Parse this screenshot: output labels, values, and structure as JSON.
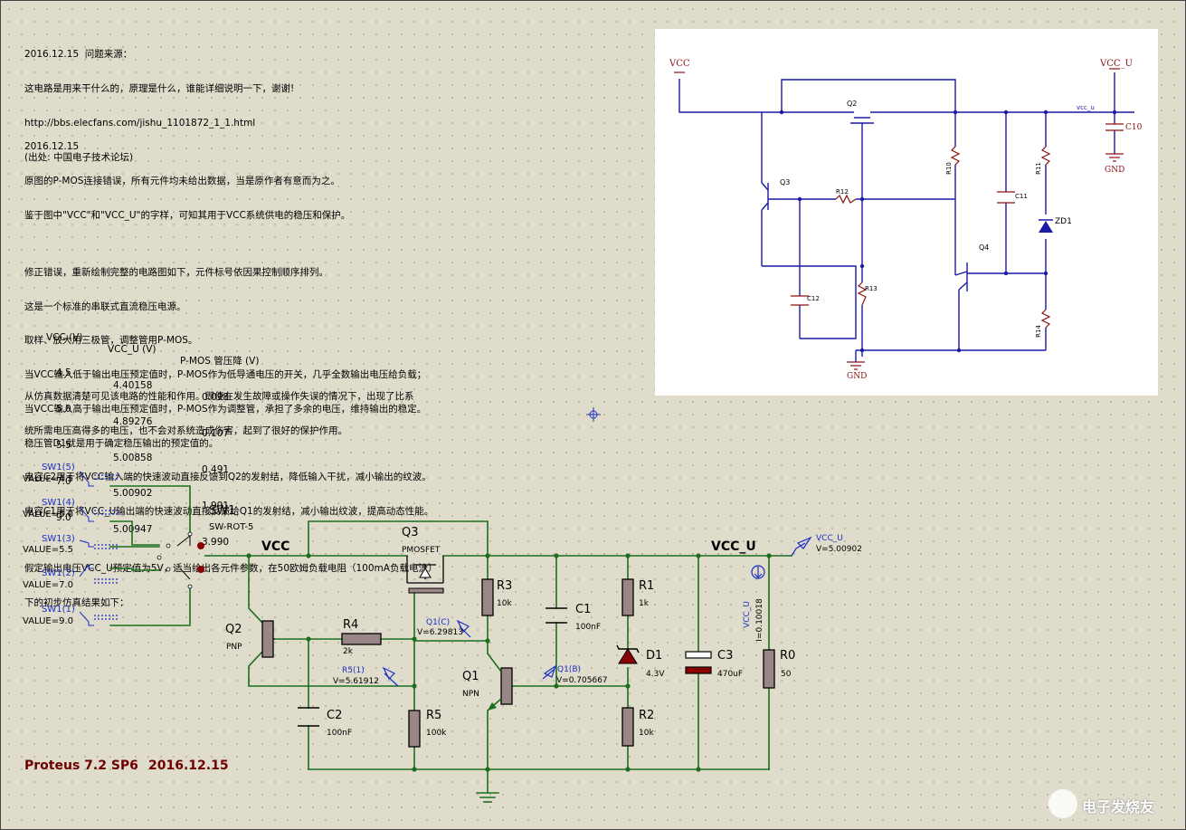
{
  "notes": {
    "block1": [
      "2016.12.15  问题来源：",
      "这电路是用来干什么的，原理是什么，谁能详细说明一下，谢谢!",
      "http://bbs.elecfans.com/jishu_1101872_1_1.html",
      "(出处: 中国电子技术论坛)"
    ],
    "block2": [
      "2016.12.15",
      "原图的P-MOS连接错误，所有元件均未给出数据，当是原作者有意而为之。",
      "鉴于图中\"VCC\"和\"VCC_U\"的字样，可知其用于VCC系统供电的稳压和保护。",
      "",
      "修正错误，重新绘制完整的电路图如下，元件标号依因果控制顺序排列。",
      "这是一个标准的串联式直流稳压电源。",
      "取样、放大用三极管，调整管用P-MOS。",
      "当VCC输入低于输出电压预定值时，P-MOS作为低导通电压的开关，几乎全数输出电压给负载；",
      "当VCC输入高于输出电压预定值时，P-MOS作为调整管，承担了多余的电压，维持输出的稳定。",
      "稳压管D1就是用于确定稳压输出的预定值的。",
      "电容C2用于将VCC输入端的快速波动直接反馈到Q2的发射结，降低输入干扰，减小输出的纹波。",
      "电容C1用于将VCC_U输出端的快速波动直接反馈给Q1的发射结，减小输出纹波，提高动态性能。",
      "",
      "假定输出电压VCC_U预定值为5V，适当给出各元件参数，在50欧姆负载电阻（100mA负载电流）",
      "下的初步仿真结果如下："
    ],
    "table": {
      "headers": [
        "VCC (V)",
        "VCC_U (V)",
        "P-MOS 管压降 (V)"
      ],
      "rows": [
        [
          "4.5",
          "4.40158",
          "0.098"
        ],
        [
          "5.0",
          "4.89276",
          "0.107"
        ],
        [
          "5.5",
          "5.00858",
          "0.491"
        ],
        [
          "7.0",
          "5.00902",
          "1.991"
        ],
        [
          "9.0",
          "5.00947",
          "3.990"
        ]
      ]
    },
    "block3": [
      "从仿真数据清楚可见该电路的性能和作用。即使在发生故障或操作失误的情况下，出现了比系",
      "统所需电压高得多的电压，也不会对系统造成伤害，起到了很好的保护作用。"
    ]
  },
  "inset": {
    "vcc": "VCC",
    "vcc_u": "VCC_U",
    "vcc_u_net": "vcc_u",
    "gnd": "GND",
    "gnd2": "GND",
    "q2": "Q2",
    "q3": "Q3",
    "q4": "Q4",
    "r10": "R10",
    "r11": "R11",
    "r12": "R12",
    "r13": "R13",
    "r14": "R14",
    "c10": "C10",
    "c11": "C11",
    "c12": "C12",
    "zd1": "ZD1"
  },
  "switch": {
    "generators": [
      {
        "name": "SW1(5)",
        "value": "VALUE=4.5"
      },
      {
        "name": "SW1(4)",
        "value": "VALUE=5.0"
      },
      {
        "name": "SW1(3)",
        "value": "VALUE=5.5"
      },
      {
        "name": "SW1(2)",
        "value": "VALUE=7.0"
      },
      {
        "name": "SW1(1)",
        "value": "VALUE=9.0"
      }
    ],
    "name": "SW1",
    "model": "SW-ROT-5"
  },
  "circuit": {
    "vcc": "VCC",
    "vcc_u": "VCC_U",
    "q3": "Q3",
    "q3_type": "PMOSFET",
    "q2": "Q2",
    "q2_type": "PNP",
    "q1": "Q1",
    "q1_type": "NPN",
    "r4": "R4",
    "r4_val": "2k",
    "r3": "R3",
    "r3_val": "10k",
    "r5": "R5",
    "r5_val": "100k",
    "r1": "R1",
    "r1_val": "1k",
    "r2": "R2",
    "r2_val": "10k",
    "r0": "R0",
    "r0_val": "50",
    "c1": "C1",
    "c1_val": "100nF",
    "c2": "C2",
    "c2_val": "100nF",
    "c3": "C3",
    "c3_val": "470uF",
    "d1": "D1",
    "d1_val": "4.3V",
    "probe_vccu_name": "VCC_U",
    "probe_vccu_val": "V=5.00902",
    "probe_q1c_name": "Q1(C)",
    "probe_q1c_val": "V=6.29813",
    "probe_r5_name": "R5(1)",
    "probe_r5_val": "V=5.61912",
    "probe_q1b_name": "Q1(B)",
    "probe_q1b_val": "V=0.705667",
    "probe_cur_name": "VCC_U",
    "probe_cur_val": "I=0.10018"
  },
  "footer": {
    "product": "Proteus 7.2 SP6",
    "date": "2016.12.15"
  },
  "watermark": "电子发烧友",
  "colors": {
    "wire": "#1c6e1c",
    "component": "#8b0000",
    "probe": "#1a2fc4",
    "inset_wire": "#1a1aa8",
    "inset_label": "#8b1010",
    "footer": "#8b0000"
  }
}
